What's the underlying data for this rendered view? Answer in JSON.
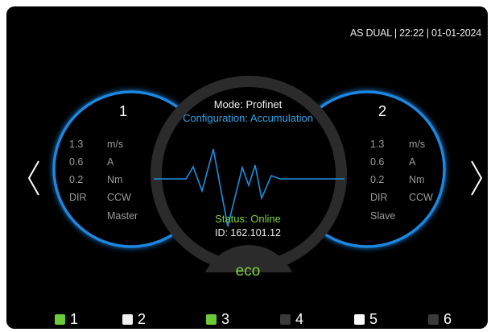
{
  "header": {
    "title": "AS DUAL | 22:22 | 01-01-2024"
  },
  "center": {
    "mode": "Mode: Profinet",
    "configuration": "Configuration: Accumulation",
    "status": "Status: Online",
    "id": "ID: 162.101.12",
    "eco_label": "eco"
  },
  "drives": [
    {
      "number": "1",
      "speed_value": "1.3",
      "speed_unit": "m/s",
      "current_value": "0.6",
      "current_unit": "A",
      "torque_value": "0.2",
      "torque_unit": "Nm",
      "dir_label": "DIR",
      "dir_value": "CCW",
      "role": "Master"
    },
    {
      "number": "2",
      "speed_value": "1.3",
      "speed_unit": "m/s",
      "current_value": "0.6",
      "current_unit": "A",
      "torque_value": "0.2",
      "torque_unit": "Nm",
      "dir_label": "DIR",
      "dir_value": "CCW",
      "role": "Slave"
    }
  ],
  "navigation": {
    "prev_icon": "chevron-left-icon",
    "next_icon": "chevron-right-icon"
  },
  "channels": [
    {
      "label": "1",
      "color": "#6cc93a"
    },
    {
      "label": "2",
      "color": "#f2f2f2"
    },
    {
      "label": "3",
      "color": "#6cc93a"
    },
    {
      "label": "4",
      "color": "#3a3a3a"
    },
    {
      "label": "5",
      "color": "#ffffff"
    },
    {
      "label": "6",
      "color": "#3a3a3a"
    }
  ],
  "colors": {
    "accent_blue": "#2fa3e8",
    "ok_green": "#7ed23a",
    "ring_dark": "#2b2b2b"
  }
}
